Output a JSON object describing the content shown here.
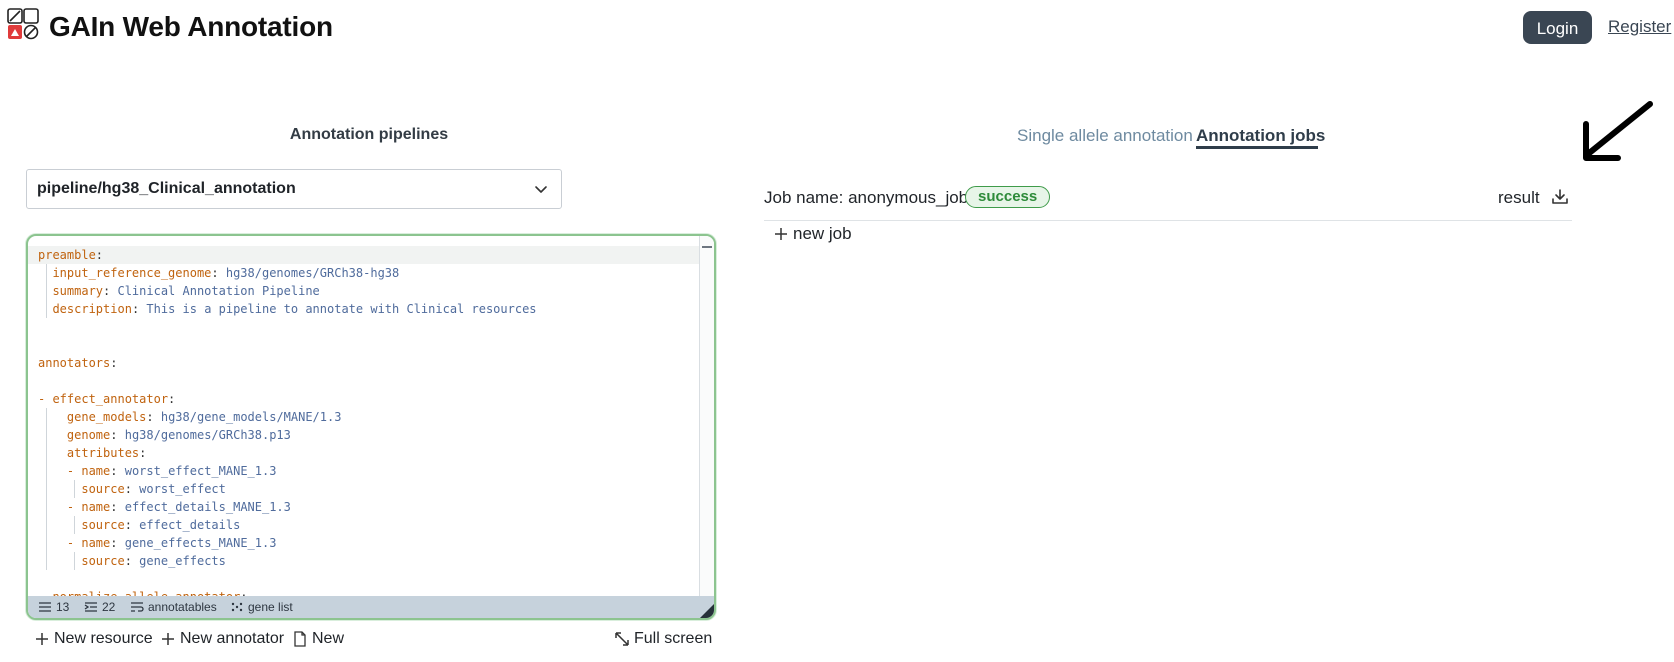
{
  "app": {
    "title": "GAIn Web Annotation",
    "login_label": "Login",
    "register_label": "Register"
  },
  "left": {
    "section_title": "Annotation pipelines",
    "pipeline_selected": "pipeline/hg38_Clinical_annotation",
    "editor_lines": [
      [
        {
          "t": "preamble",
          "c": "k"
        },
        {
          "t": ":",
          "c": "p"
        }
      ],
      [
        {
          "t": "  ",
          "c": "p"
        },
        {
          "t": "input_reference_genome",
          "c": "k"
        },
        {
          "t": ": ",
          "c": "p"
        },
        {
          "t": "hg38/genomes/GRCh38-hg38",
          "c": "v"
        }
      ],
      [
        {
          "t": "  ",
          "c": "p"
        },
        {
          "t": "summary",
          "c": "k"
        },
        {
          "t": ": ",
          "c": "p"
        },
        {
          "t": "Clinical Annotation Pipeline",
          "c": "v"
        }
      ],
      [
        {
          "t": "  ",
          "c": "p"
        },
        {
          "t": "description",
          "c": "k"
        },
        {
          "t": ": ",
          "c": "p"
        },
        {
          "t": "This is a pipeline to annotate with Clinical resources",
          "c": "v"
        }
      ],
      [],
      [],
      [
        {
          "t": "annotators",
          "c": "k"
        },
        {
          "t": ":",
          "c": "p"
        }
      ],
      [],
      [
        {
          "t": "- ",
          "c": "k"
        },
        {
          "t": "effect_annotator",
          "c": "k"
        },
        {
          "t": ":",
          "c": "p"
        }
      ],
      [
        {
          "t": "    ",
          "c": "p"
        },
        {
          "t": "gene_models",
          "c": "k"
        },
        {
          "t": ": ",
          "c": "p"
        },
        {
          "t": "hg38/gene_models/MANE/1.3",
          "c": "v"
        }
      ],
      [
        {
          "t": "    ",
          "c": "p"
        },
        {
          "t": "genome",
          "c": "k"
        },
        {
          "t": ": ",
          "c": "p"
        },
        {
          "t": "hg38/genomes/GRCh38.p13",
          "c": "v"
        }
      ],
      [
        {
          "t": "    ",
          "c": "p"
        },
        {
          "t": "attributes",
          "c": "k"
        },
        {
          "t": ":",
          "c": "p"
        }
      ],
      [
        {
          "t": "    ",
          "c": "p"
        },
        {
          "t": "- ",
          "c": "k"
        },
        {
          "t": "name",
          "c": "k"
        },
        {
          "t": ": ",
          "c": "p"
        },
        {
          "t": "worst_effect_MANE_1.3",
          "c": "v"
        }
      ],
      [
        {
          "t": "      ",
          "c": "p"
        },
        {
          "t": "source",
          "c": "k"
        },
        {
          "t": ": ",
          "c": "p"
        },
        {
          "t": "worst_effect",
          "c": "v"
        }
      ],
      [
        {
          "t": "    ",
          "c": "p"
        },
        {
          "t": "- ",
          "c": "k"
        },
        {
          "t": "name",
          "c": "k"
        },
        {
          "t": ": ",
          "c": "p"
        },
        {
          "t": "effect_details_MANE_1.3",
          "c": "v"
        }
      ],
      [
        {
          "t": "      ",
          "c": "p"
        },
        {
          "t": "source",
          "c": "k"
        },
        {
          "t": ": ",
          "c": "p"
        },
        {
          "t": "effect_details",
          "c": "v"
        }
      ],
      [
        {
          "t": "    ",
          "c": "p"
        },
        {
          "t": "- ",
          "c": "k"
        },
        {
          "t": "name",
          "c": "k"
        },
        {
          "t": ": ",
          "c": "p"
        },
        {
          "t": "gene_effects_MANE_1.3",
          "c": "v"
        }
      ],
      [
        {
          "t": "      ",
          "c": "p"
        },
        {
          "t": "source",
          "c": "k"
        },
        {
          "t": ": ",
          "c": "p"
        },
        {
          "t": "gene_effects",
          "c": "v"
        }
      ],
      [],
      [
        {
          "t": "- ",
          "c": "k"
        },
        {
          "t": "normalize_allele_annotator",
          "c": "k"
        },
        {
          "t": ":",
          "c": "p"
        }
      ]
    ],
    "status": {
      "lines": "13",
      "indent": "22",
      "annotatables": "annotatables",
      "gene_list": "gene list"
    },
    "actions": {
      "new_resource": "New resource",
      "new_annotator": "New annotator",
      "new": "New",
      "full_screen": "Full screen"
    }
  },
  "right": {
    "tabs": [
      {
        "label": "Single allele annotation",
        "active": false
      },
      {
        "label": "Annotation jobs",
        "active": true
      }
    ],
    "job": {
      "name_text": "Job name: anonymous_job",
      "status": "success",
      "result_label": "result"
    },
    "new_job_label": "new job"
  },
  "colors": {
    "accent_dark": "#3a4653",
    "success_green": "#2e8b3a",
    "editor_border": "#8cc48f",
    "yaml_key": "#c0630f",
    "yaml_value": "#4f6b9c"
  }
}
